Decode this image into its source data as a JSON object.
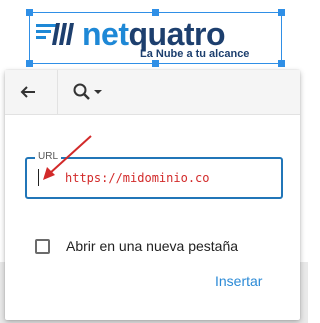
{
  "logo": {
    "name_part1": "net",
    "name_part2": "quatro",
    "tagline": "La Nube a  tu alcance"
  },
  "toolbar": {
    "back_icon": "arrow-left-icon",
    "search_icon": "magnifier-icon",
    "dropdown_icon": "caret-down-icon"
  },
  "url_field": {
    "label": "URL",
    "value": "https://midominio.co"
  },
  "options": {
    "new_tab_label": "Abrir en una nueva pestaña",
    "new_tab_checked": false
  },
  "actions": {
    "insert_label": "Insertar"
  },
  "colors": {
    "accent": "#2b8ad6",
    "field_border": "#2176b8",
    "annotation_red": "#d22a2a",
    "logo_dark": "#1d3f6e",
    "logo_light": "#1e88d6"
  }
}
